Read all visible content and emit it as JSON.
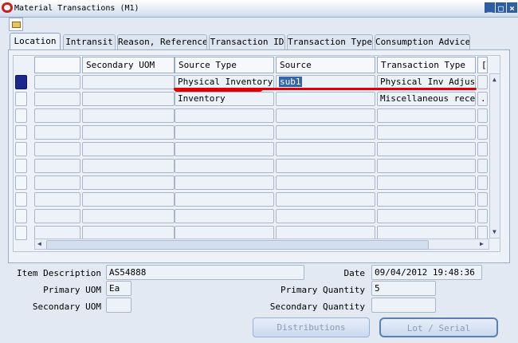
{
  "window": {
    "title": "Material Transactions (M1)"
  },
  "tabs": [
    {
      "label": "Location",
      "active": true
    },
    {
      "label": "Intransit",
      "active": false
    },
    {
      "label": "Reason, Reference",
      "active": false
    },
    {
      "label": "Transaction ID",
      "active": false
    },
    {
      "label": "Transaction Type",
      "active": false
    },
    {
      "label": "Consumption Advice",
      "active": false
    }
  ],
  "grid": {
    "columns": [
      "",
      "Secondary UOM",
      "Source Type",
      "Source",
      "Transaction Type",
      "["
    ],
    "rows": [
      {
        "source_type": "Physical Inventory",
        "source": "sub1",
        "transaction_type": "Physical Inv Adjust"
      },
      {
        "source_type": "Inventory",
        "source": "",
        "transaction_type": "Miscellaneous receip",
        "extra": "."
      }
    ]
  },
  "details": {
    "item_description_label": "Item Description",
    "item_description": "AS54888",
    "date_label": "Date",
    "date": "09/04/2012 19:48:36",
    "primary_uom_label": "Primary UOM",
    "primary_uom": "Ea",
    "primary_quantity_label": "Primary Quantity",
    "primary_quantity": "5",
    "secondary_uom_label": "Secondary UOM",
    "secondary_uom": "",
    "secondary_quantity_label": "Secondary Quantity",
    "secondary_quantity": ""
  },
  "buttons": {
    "distributions": "Distributions",
    "lot_serial": "Lot / Serial"
  },
  "colors": {
    "selected_row_indicator": "#1b2a8a",
    "source_highlight": "#3a64a8",
    "annotation_underline": "#e00000"
  }
}
